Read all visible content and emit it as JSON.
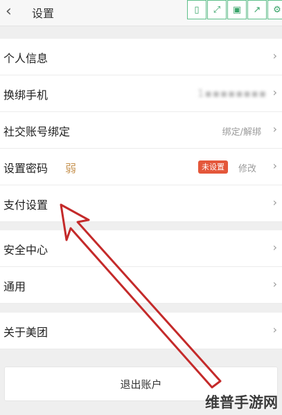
{
  "header": {
    "back_icon": "chevron-left-icon",
    "title": "设置",
    "toolbar_icons": [
      "phone-icon",
      "expand-icon",
      "save-icon",
      "share-icon",
      "gear-icon"
    ]
  },
  "rows": {
    "personal_info": {
      "label": "个人信息"
    },
    "change_phone": {
      "label": "换绑手机",
      "value": "1▪▪▪▪▪▪▪▪"
    },
    "social_binding": {
      "label": "社交账号绑定",
      "value": "绑定/解绑"
    },
    "password": {
      "label": "设置密码",
      "strength": "弱",
      "badge": "未设置",
      "action": "修改"
    },
    "payment": {
      "label": "支付设置"
    },
    "security_center": {
      "label": "安全中心"
    },
    "general": {
      "label": "通用"
    },
    "about": {
      "label": "关于美团"
    }
  },
  "logout": {
    "label": "退出账户"
  },
  "watermark": "维普手游网",
  "colors": {
    "badge": "#e4573a",
    "weak_text": "#c89656",
    "annotation_arrow": "#c42a2a",
    "toolbar_accent": "#3aa56a"
  }
}
